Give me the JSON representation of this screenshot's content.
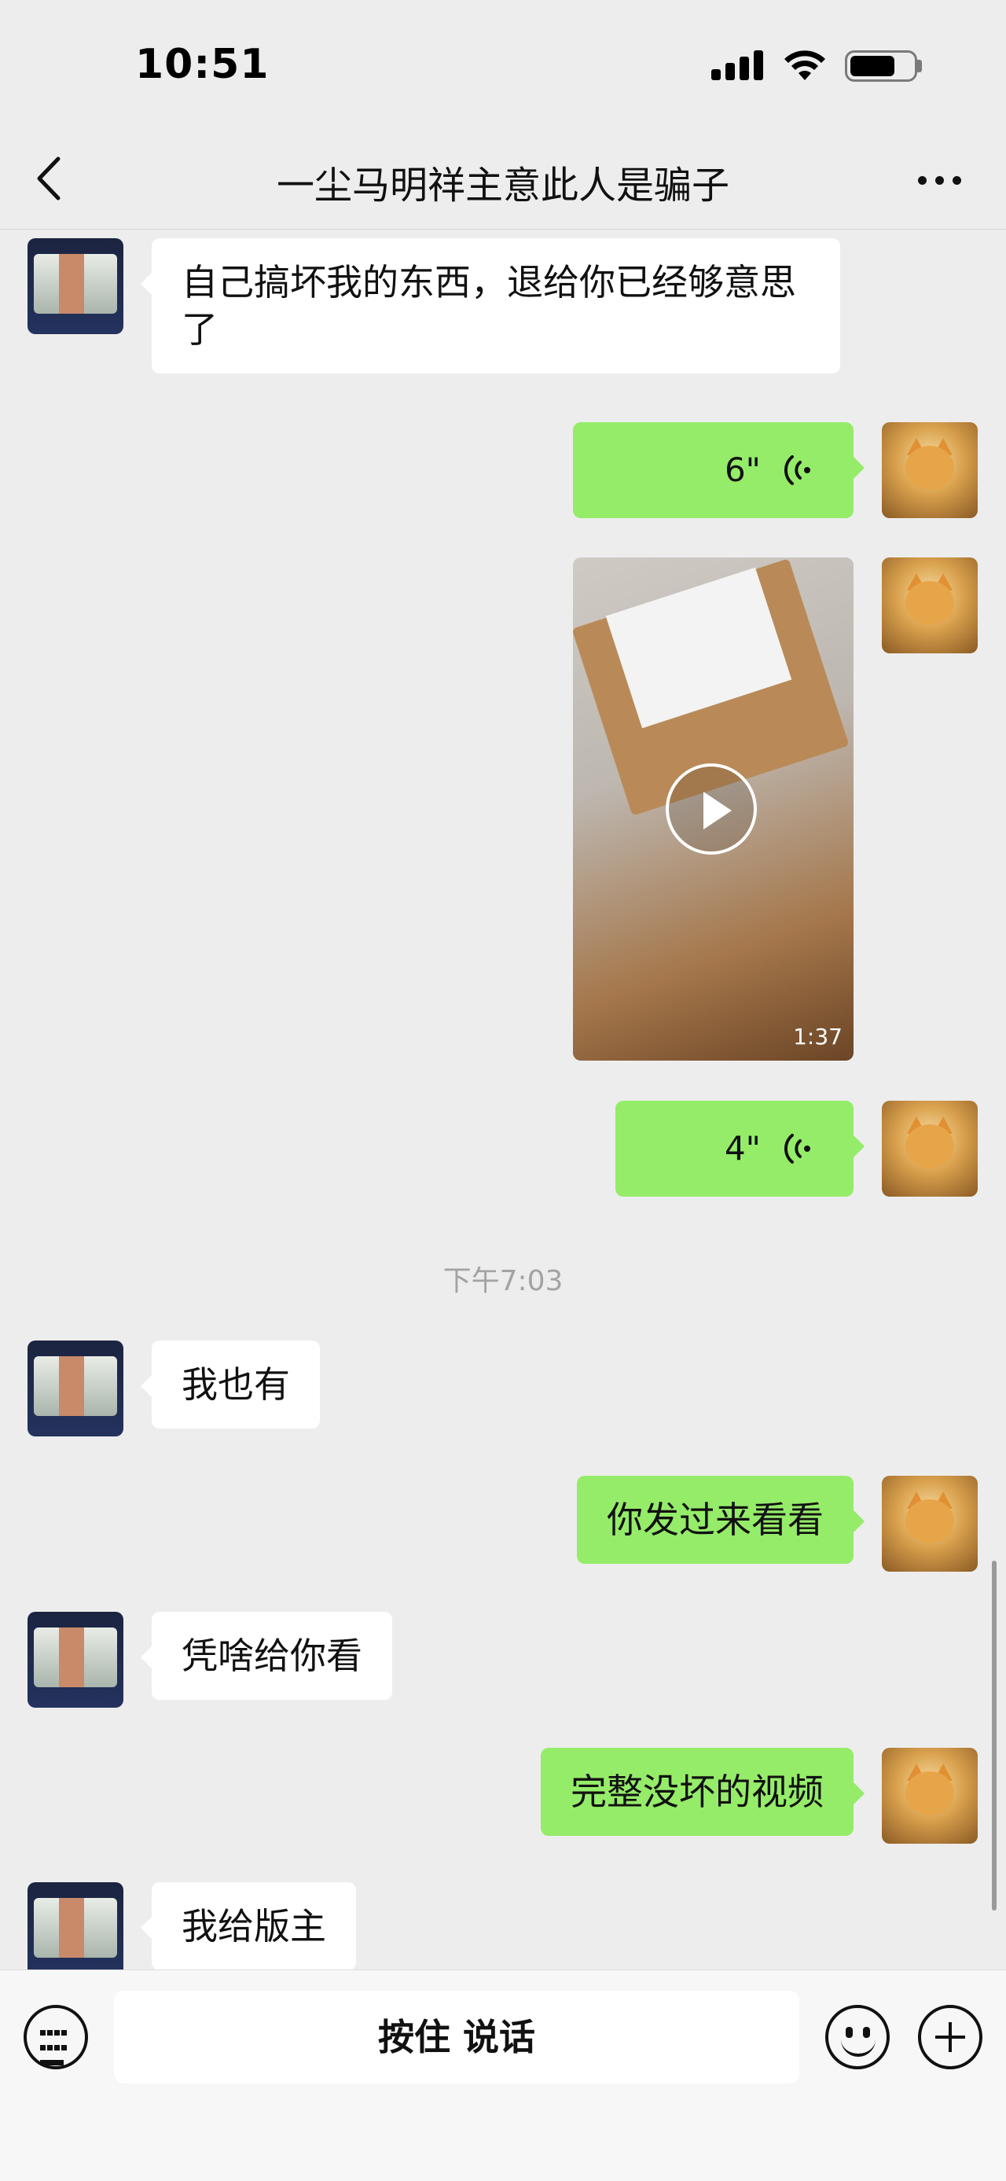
{
  "status_bar": {
    "time": "10:51"
  },
  "header": {
    "title": "一尘马明祥主意此人是骗子"
  },
  "messages": [
    {
      "side": "in",
      "type": "text",
      "text": "自己搞坏我的东西，退给你已经够意思了"
    },
    {
      "side": "out",
      "type": "voice",
      "duration": "6\""
    },
    {
      "side": "out",
      "type": "video",
      "duration": "1:37"
    },
    {
      "side": "out",
      "type": "voice",
      "duration": "4\""
    },
    {
      "type": "timestamp",
      "text": "下午7:03"
    },
    {
      "side": "in",
      "type": "text",
      "text": "我也有"
    },
    {
      "side": "out",
      "type": "text",
      "text": "你发过来看看"
    },
    {
      "side": "in",
      "type": "text",
      "text": "凭啥给你看"
    },
    {
      "side": "out",
      "type": "text",
      "text": "完整没坏的视频"
    },
    {
      "side": "in",
      "type": "text",
      "text": "我给版主"
    }
  ],
  "input_bar": {
    "hold_to_talk_label": "按住 说话"
  },
  "icons": {
    "back": "chevron-left-icon",
    "more": "more-dots-icon",
    "voice_wave": "voice-wave-icon",
    "play": "play-icon",
    "keyboard": "keyboard-icon",
    "emoji": "emoji-icon",
    "plus": "plus-icon"
  },
  "colors": {
    "outgoing_bubble": "#95ec69",
    "incoming_bubble": "#ffffff",
    "background": "#ededed"
  }
}
